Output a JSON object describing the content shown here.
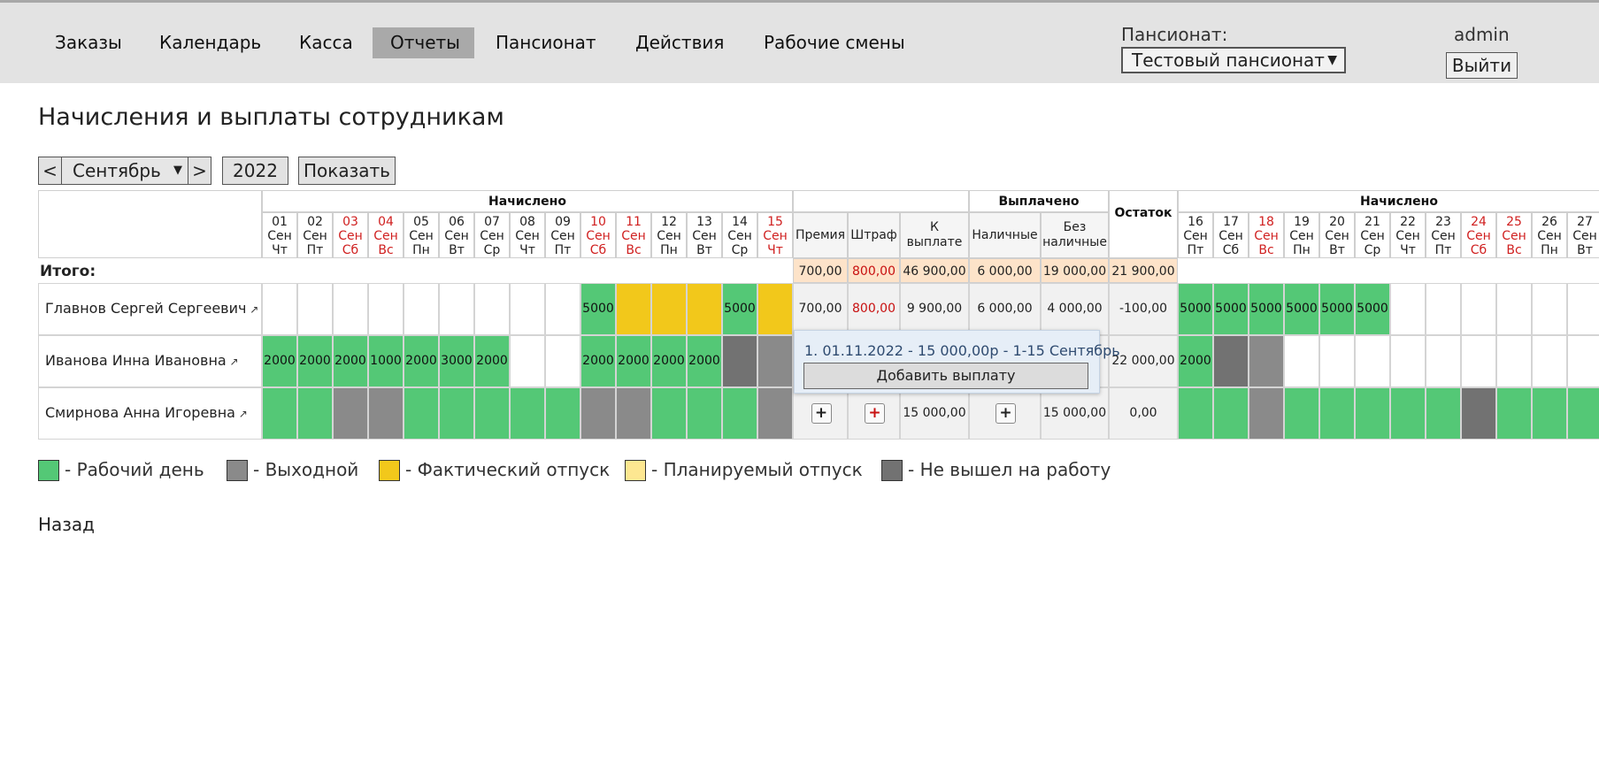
{
  "nav": {
    "items": [
      "Заказы",
      "Календарь",
      "Касса",
      "Отчеты",
      "Пансионат",
      "Действия",
      "Рабочие смены"
    ],
    "active": "Отчеты"
  },
  "pensionat": {
    "label": "Пансионат:",
    "selected": "Тестовый пансионат"
  },
  "user": {
    "name": "admin",
    "logout": "Выйти"
  },
  "page_title": "Начисления и выплаты сотрудникам",
  "controls": {
    "prev": "<",
    "month": "Сентябрь",
    "next": ">",
    "year": "2022",
    "show": "Показать"
  },
  "headers": {
    "accrued": "Начислено",
    "paid": "Выплачено",
    "remainder": "Остаток",
    "bonus": "Премия",
    "fine": "Штраф",
    "to_pay": "К выплате",
    "cash": "Наличные",
    "noncash": "Без наличные"
  },
  "days1": [
    {
      "d": "01",
      "m": "Сен",
      "w": "Чт",
      "we": false
    },
    {
      "d": "02",
      "m": "Сен",
      "w": "Пт",
      "we": false
    },
    {
      "d": "03",
      "m": "Сен",
      "w": "Сб",
      "we": true
    },
    {
      "d": "04",
      "m": "Сен",
      "w": "Вс",
      "we": true
    },
    {
      "d": "05",
      "m": "Сен",
      "w": "Пн",
      "we": false
    },
    {
      "d": "06",
      "m": "Сен",
      "w": "Вт",
      "we": false
    },
    {
      "d": "07",
      "m": "Сен",
      "w": "Ср",
      "we": false
    },
    {
      "d": "08",
      "m": "Сен",
      "w": "Чт",
      "we": false
    },
    {
      "d": "09",
      "m": "Сен",
      "w": "Пт",
      "we": false
    },
    {
      "d": "10",
      "m": "Сен",
      "w": "Сб",
      "we": true
    },
    {
      "d": "11",
      "m": "Сен",
      "w": "Вс",
      "we": true
    },
    {
      "d": "12",
      "m": "Сен",
      "w": "Пн",
      "we": false
    },
    {
      "d": "13",
      "m": "Сен",
      "w": "Вт",
      "we": false
    },
    {
      "d": "14",
      "m": "Сен",
      "w": "Ср",
      "we": false
    },
    {
      "d": "15",
      "m": "Сен",
      "w": "Чт",
      "we": true
    }
  ],
  "days2": [
    {
      "d": "16",
      "m": "Сен",
      "w": "Пт",
      "we": false
    },
    {
      "d": "17",
      "m": "Сен",
      "w": "Сб",
      "we": false
    },
    {
      "d": "18",
      "m": "Сен",
      "w": "Вс",
      "we": true
    },
    {
      "d": "19",
      "m": "Сен",
      "w": "Пн",
      "we": false
    },
    {
      "d": "20",
      "m": "Сен",
      "w": "Вт",
      "we": false
    },
    {
      "d": "21",
      "m": "Сен",
      "w": "Ср",
      "we": false
    },
    {
      "d": "22",
      "m": "Сен",
      "w": "Чт",
      "we": false
    },
    {
      "d": "23",
      "m": "Сен",
      "w": "Пт",
      "we": false
    },
    {
      "d": "24",
      "m": "Сен",
      "w": "Сб",
      "we": true
    },
    {
      "d": "25",
      "m": "Сен",
      "w": "Вс",
      "we": true
    },
    {
      "d": "26",
      "m": "Сен",
      "w": "Пн",
      "we": false
    },
    {
      "d": "27",
      "m": "Сен",
      "w": "Вт",
      "we": false
    }
  ],
  "totals": {
    "label": "Итого:",
    "bonus": "700,00",
    "fine": "800,00",
    "to_pay": "46 900,00",
    "cash": "6 000,00",
    "noncash": "19 000,00",
    "remainder": "21 900,00"
  },
  "employees": [
    {
      "name": "Главнов Сергей Сергеевич",
      "cells1": [
        [
          "W",
          ""
        ],
        [
          "W",
          ""
        ],
        [
          "W",
          ""
        ],
        [
          "W",
          ""
        ],
        [
          "W",
          ""
        ],
        [
          "W",
          ""
        ],
        [
          "W",
          ""
        ],
        [
          "W",
          ""
        ],
        [
          "W",
          ""
        ],
        [
          "G",
          "5000"
        ],
        [
          "Y",
          ""
        ],
        [
          "Y",
          ""
        ],
        [
          "Y",
          ""
        ],
        [
          "G",
          "5000"
        ],
        [
          "Y",
          ""
        ]
      ],
      "bonus": "700,00",
      "fine": "800,00",
      "to_pay": "9 900,00",
      "cash": "6 000,00",
      "noncash": "4 000,00",
      "remainder": "-100,00",
      "cells2": [
        [
          "G",
          "5000"
        ],
        [
          "G",
          "5000"
        ],
        [
          "G",
          "5000"
        ],
        [
          "G",
          "5000"
        ],
        [
          "G",
          "5000"
        ],
        [
          "G",
          "5000"
        ],
        [
          "W",
          ""
        ],
        [
          "W",
          ""
        ],
        [
          "W",
          ""
        ],
        [
          "W",
          ""
        ],
        [
          "W",
          ""
        ],
        [
          "W",
          ""
        ]
      ]
    },
    {
      "name": "Иванова Инна Ивановна",
      "cells1": [
        [
          "G",
          "2000"
        ],
        [
          "G",
          "2000"
        ],
        [
          "G",
          "2000"
        ],
        [
          "G",
          "1000"
        ],
        [
          "G",
          "2000"
        ],
        [
          "G",
          "3000"
        ],
        [
          "G",
          "2000"
        ],
        [
          "W",
          ""
        ],
        [
          "W",
          ""
        ],
        [
          "G",
          "2000"
        ],
        [
          "G",
          "2000"
        ],
        [
          "G",
          "2000"
        ],
        [
          "G",
          "2000"
        ],
        [
          "D",
          ""
        ],
        [
          "K",
          ""
        ]
      ],
      "remainder": "22 000,00",
      "cells2": [
        [
          "G",
          "2000"
        ],
        [
          "D",
          ""
        ],
        [
          "K",
          ""
        ],
        [
          "W",
          ""
        ],
        [
          "W",
          ""
        ],
        [
          "W",
          ""
        ],
        [
          "W",
          ""
        ],
        [
          "W",
          ""
        ],
        [
          "W",
          ""
        ],
        [
          "W",
          ""
        ],
        [
          "W",
          ""
        ],
        [
          "W",
          ""
        ]
      ]
    },
    {
      "name": "Смирнова Анна Игоревна",
      "cells1": [
        [
          "G",
          ""
        ],
        [
          "G",
          ""
        ],
        [
          "K",
          ""
        ],
        [
          "K",
          ""
        ],
        [
          "G",
          ""
        ],
        [
          "G",
          ""
        ],
        [
          "G",
          ""
        ],
        [
          "G",
          ""
        ],
        [
          "G",
          ""
        ],
        [
          "K",
          ""
        ],
        [
          "K",
          ""
        ],
        [
          "G",
          ""
        ],
        [
          "G",
          ""
        ],
        [
          "G",
          ""
        ],
        [
          "K",
          ""
        ]
      ],
      "plus": "+",
      "to_pay": "15 000,00",
      "noncash": "15 000,00",
      "remainder": "0,00",
      "cells2": [
        [
          "G",
          ""
        ],
        [
          "G",
          ""
        ],
        [
          "K",
          ""
        ],
        [
          "G",
          ""
        ],
        [
          "G",
          ""
        ],
        [
          "G",
          ""
        ],
        [
          "G",
          ""
        ],
        [
          "G",
          ""
        ],
        [
          "D",
          ""
        ],
        [
          "G",
          ""
        ],
        [
          "G",
          ""
        ],
        [
          "G",
          ""
        ]
      ]
    }
  ],
  "popup": {
    "line": "1. 01.11.2022 - 15 000,00р - 1-15 Сентябрь",
    "button": "Добавить выплату"
  },
  "legend": [
    {
      "color": "#54c876",
      "label": "- Рабочий день"
    },
    {
      "color": "#8a8a8a",
      "label": "- Выходной"
    },
    {
      "color": "#f2c81b",
      "label": "- Фактический отпуск"
    },
    {
      "color": "#fde791",
      "label": "- Планируемый отпуск"
    },
    {
      "color": "#727272",
      "label": "- Не вышел на работу"
    }
  ],
  "back": "Назад"
}
